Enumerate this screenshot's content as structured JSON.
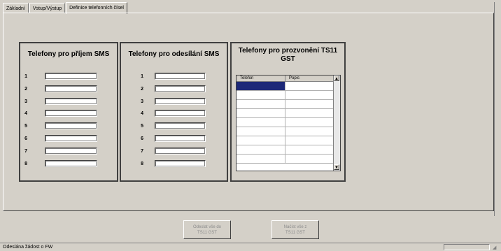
{
  "tabs": [
    {
      "label": "Základní"
    },
    {
      "label": "Vstup/Výstup"
    },
    {
      "label": "Definice telefonních čísel"
    }
  ],
  "groups": {
    "receive_sms": {
      "title": "Telefony pro příjem SMS",
      "rows": [
        {
          "num": "1",
          "value": ""
        },
        {
          "num": "2",
          "value": ""
        },
        {
          "num": "3",
          "value": ""
        },
        {
          "num": "4",
          "value": ""
        },
        {
          "num": "5",
          "value": ""
        },
        {
          "num": "6",
          "value": ""
        },
        {
          "num": "7",
          "value": ""
        },
        {
          "num": "8",
          "value": ""
        }
      ]
    },
    "send_sms": {
      "title": "Telefony pro odesílání SMS",
      "rows": [
        {
          "num": "1",
          "value": ""
        },
        {
          "num": "2",
          "value": ""
        },
        {
          "num": "3",
          "value": ""
        },
        {
          "num": "4",
          "value": ""
        },
        {
          "num": "5",
          "value": ""
        },
        {
          "num": "6",
          "value": ""
        },
        {
          "num": "7",
          "value": ""
        },
        {
          "num": "8",
          "value": ""
        }
      ]
    },
    "ring_ts11": {
      "title": "Telefony pro prozvonění TS11 GST",
      "columns": [
        "Telefon",
        "Popis"
      ]
    }
  },
  "buttons": {
    "send_all": "Odeslat vše do\nTS11 GST",
    "read_all": "Načíst vše z\nTS11 GST"
  },
  "statusbar": {
    "text": "Odeslána žádost o FW"
  },
  "icons": {
    "scroll_up": "scroll-up-arrow-icon",
    "scroll_down": "scroll-down-arrow-icon"
  },
  "colors": {
    "face": "#d4d0c8",
    "selection": "#1c2878"
  }
}
